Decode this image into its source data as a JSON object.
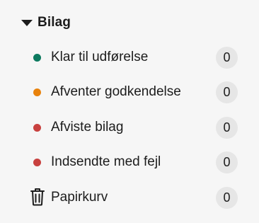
{
  "section": {
    "title": "Bilag",
    "icon": "caret-down-icon",
    "items": [
      {
        "label": "Klar til udførelse",
        "count": "0",
        "color": "#0d7a5f",
        "icon": "status-dot"
      },
      {
        "label": "Afventer godkendelse",
        "count": "0",
        "color": "#e8820c",
        "icon": "status-dot"
      },
      {
        "label": "Afviste bilag",
        "count": "0",
        "color": "#c8413f",
        "icon": "status-dot"
      },
      {
        "label": "Indsendte med fejl",
        "count": "0",
        "color": "#c8413f",
        "icon": "status-dot"
      },
      {
        "label": "Papirkurv",
        "count": "0",
        "icon": "trash-icon"
      }
    ]
  }
}
